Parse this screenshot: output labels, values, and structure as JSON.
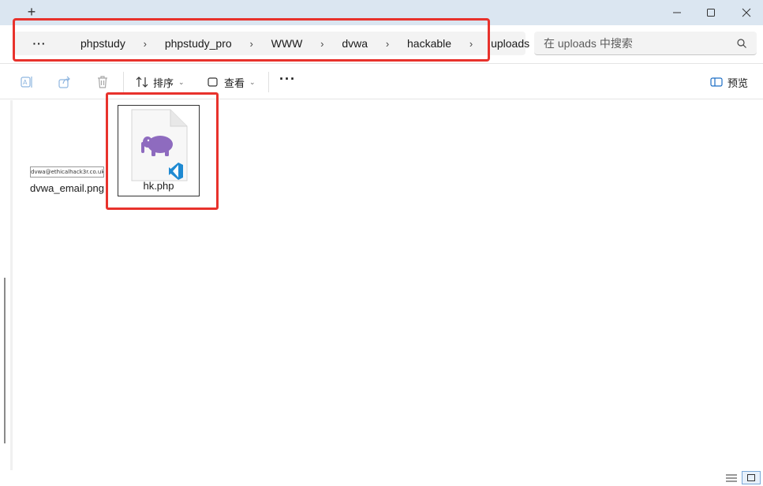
{
  "window": {
    "new_tab_label": "+"
  },
  "breadcrumb": {
    "more_label": "···",
    "separator": "›",
    "items": [
      "phpstudy",
      "phpstudy_pro",
      "WWW",
      "dvwa",
      "hackable",
      "uploads"
    ]
  },
  "search": {
    "placeholder": "在 uploads 中搜索"
  },
  "toolbar": {
    "sort_label": "排序",
    "view_label": "查看",
    "more_label": "···",
    "preview_label": "预览"
  },
  "files": [
    {
      "name": "dvwa_email.png",
      "thumbnail_text": "dvwa@ethicalhack3r.co.uk"
    },
    {
      "name": "hk.php"
    }
  ],
  "colors": {
    "highlight": "#e8322c",
    "titlebar": "#dbe6f1",
    "php_elephant": "#8e6bbf",
    "vscode_badge": "#1f8ad2"
  },
  "icons": [
    "rename-icon",
    "share-icon",
    "delete-icon",
    "sort-icon",
    "view-icon",
    "more-icon",
    "preview-pane-icon",
    "search-icon",
    "php-file-icon",
    "vscode-badge-icon"
  ]
}
